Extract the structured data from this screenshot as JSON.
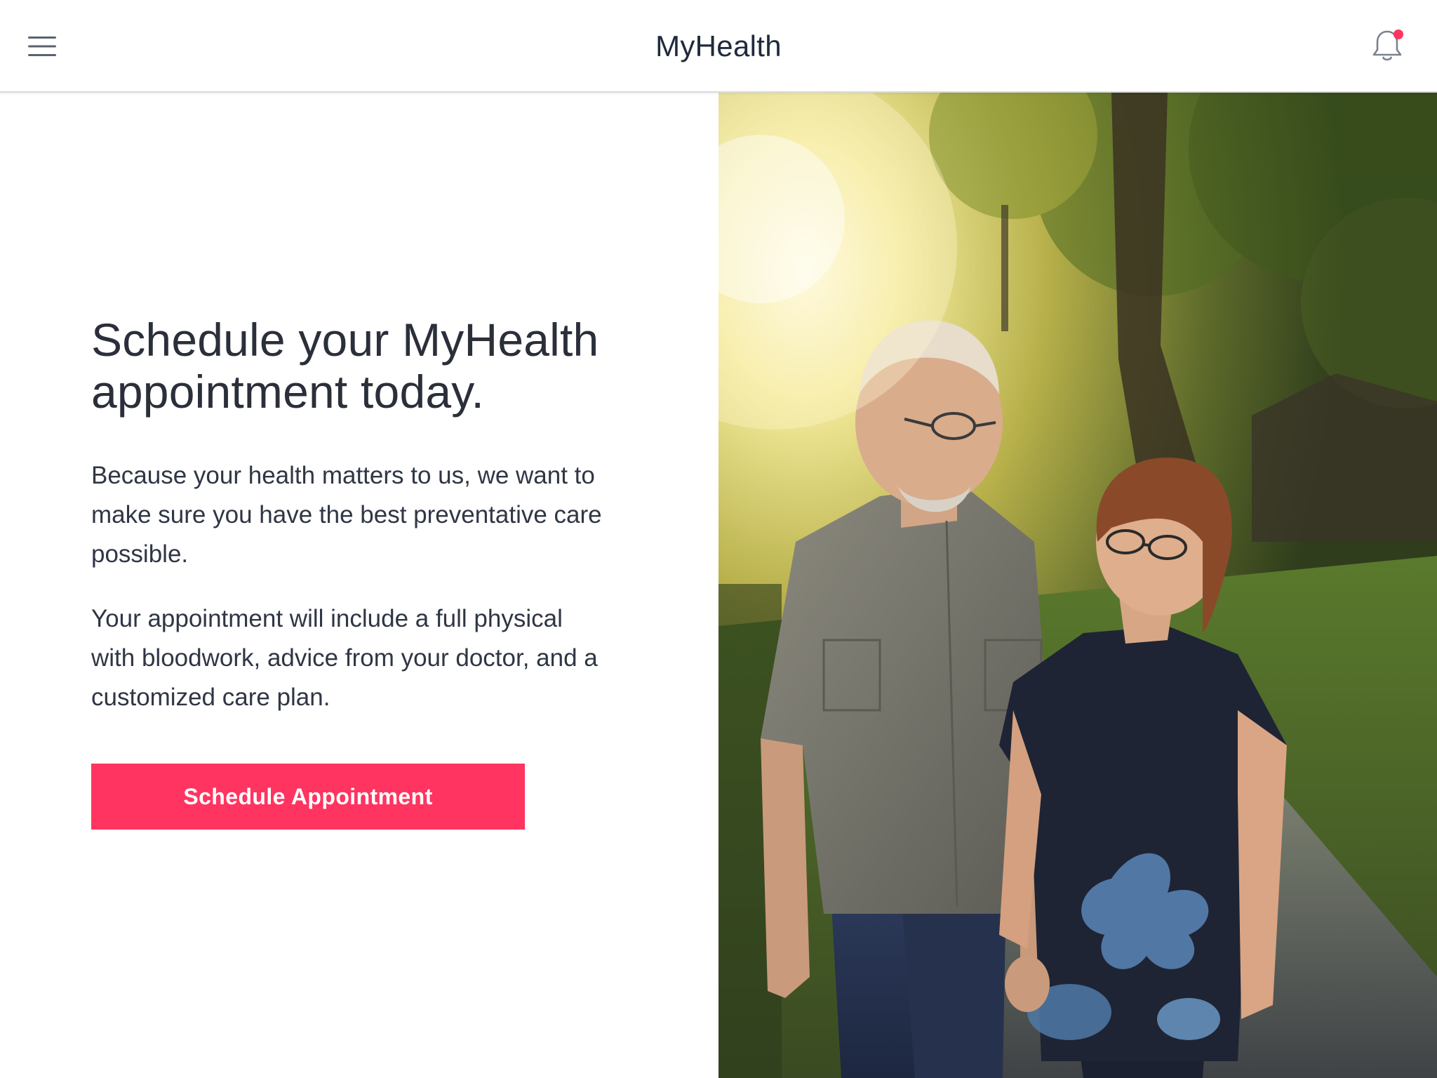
{
  "header": {
    "title": "MyHealth",
    "menu_icon": "hamburger-menu-icon",
    "notification_icon": "bell-icon",
    "notification_dot_color": "#ff3460"
  },
  "hero": {
    "headline": "Schedule your MyHealth appointment today.",
    "paragraph_1": "Because your health matters to us, we want to make sure you have the best preventative care possible.",
    "paragraph_2": "Your appointment will include a full physical with bloodwork, advice from your doctor, and a customized care plan.",
    "cta_label": "Schedule Appointment"
  },
  "image": {
    "subject": "Older couple smiling at each other, walking hand in hand on a sunlit tree-lined path"
  },
  "colors": {
    "accent": "#ff3460",
    "text": "#2a2f3a",
    "header_border": "#d9dbe0"
  }
}
